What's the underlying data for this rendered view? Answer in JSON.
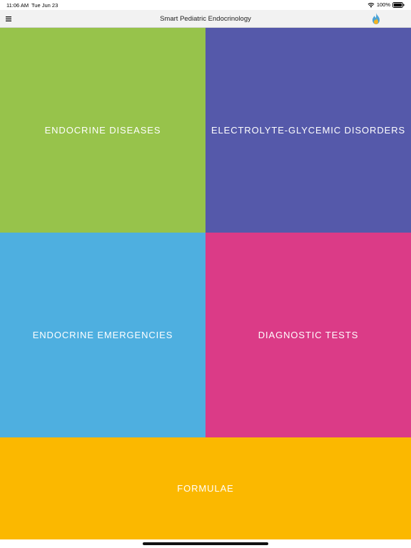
{
  "status_bar": {
    "time": "11:06 AM",
    "date": "Tue Jun 23",
    "battery": "100%",
    "icons": [
      "wifi-icon",
      "battery-icon"
    ]
  },
  "nav_bar": {
    "title": "Smart Pediatric Endocrinology",
    "menu_icon": "hamburger-menu-icon",
    "logo_icon": "flame-logo-icon"
  },
  "tiles": [
    {
      "label": "ENDOCRINE DISEASES",
      "color": "#97c34b"
    },
    {
      "label": "ELECTROLYTE-GLYCEMIC DISORDERS",
      "color": "#5559aa"
    },
    {
      "label": "ENDOCRINE EMERGENCIES",
      "color": "#4eafe0"
    },
    {
      "label": "DIAGNOSTIC TESTS",
      "color": "#db3b87"
    },
    {
      "label": "FORMULAE",
      "color": "#fbb800"
    }
  ]
}
